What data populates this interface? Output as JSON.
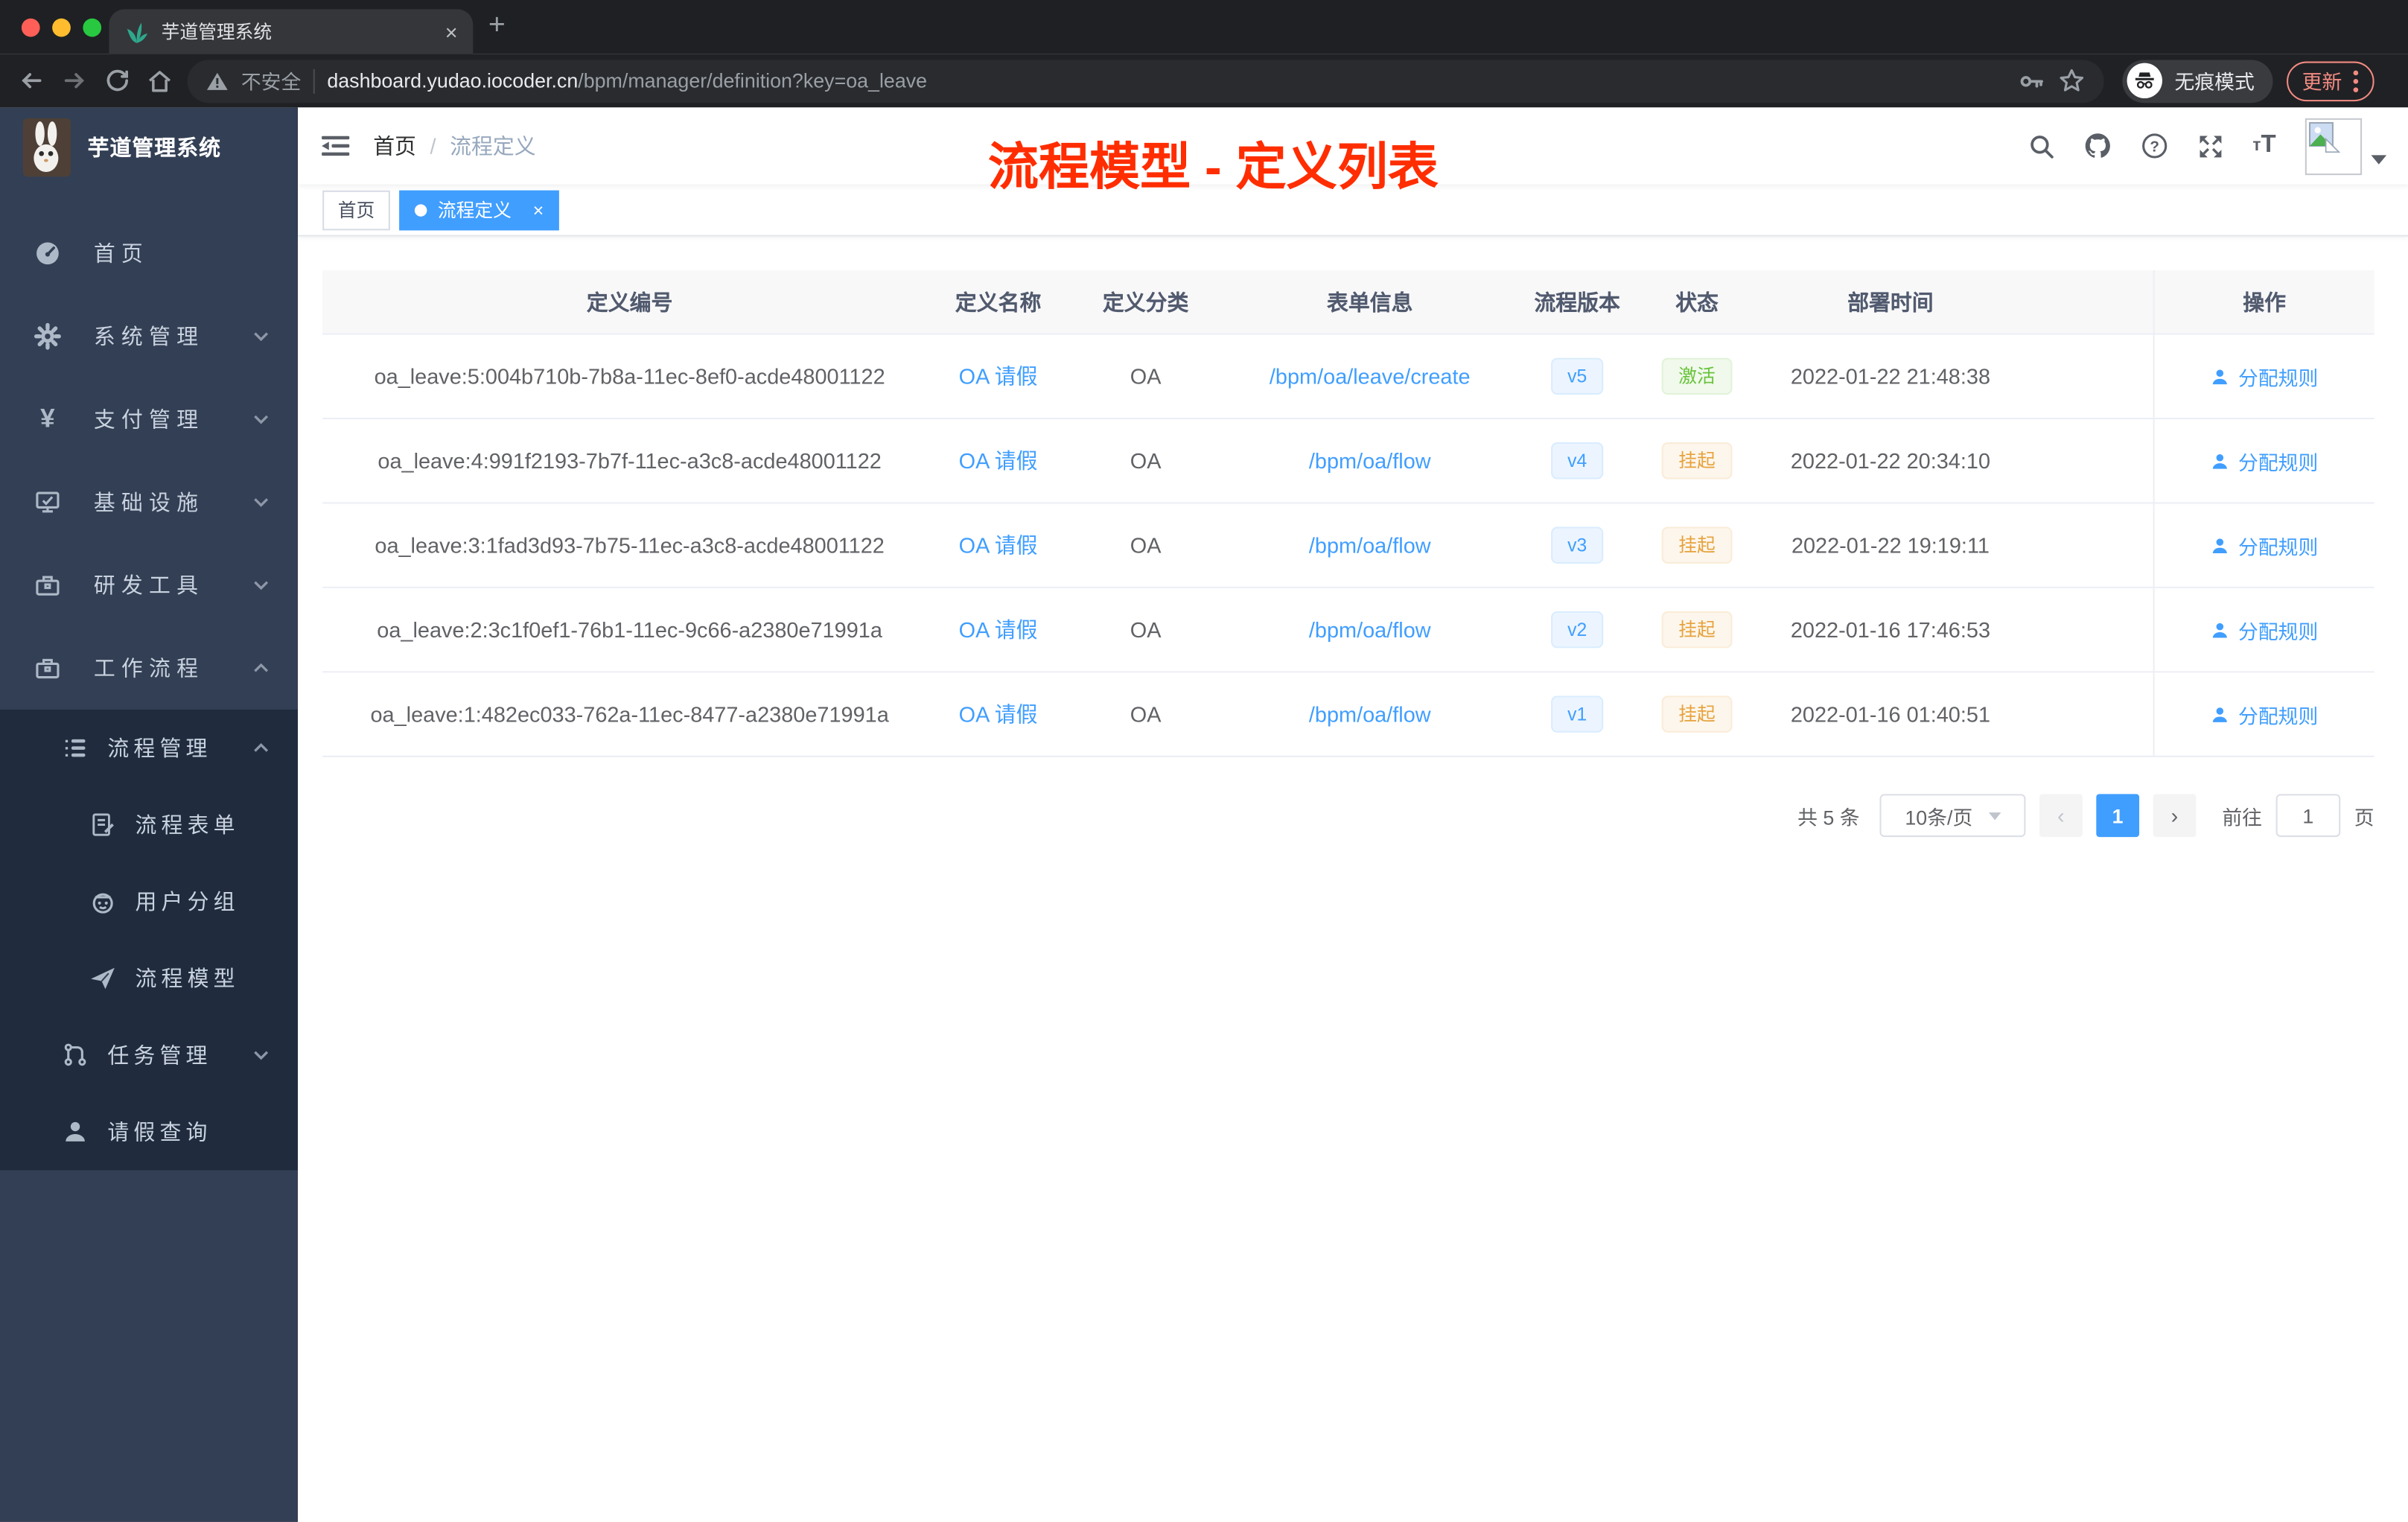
{
  "browser": {
    "tab_title": "芋道管理系统",
    "new_tab_label": "+",
    "close_tab_label": "×",
    "security_label": "不安全",
    "url_host": "dashboard.yudao.iocoder.cn",
    "url_path": "/bpm/manager/definition?key=oa_leave",
    "incognito_label": "无痕模式",
    "update_label": "更新"
  },
  "sidebar": {
    "app_title": "芋道管理系统",
    "items": [
      {
        "label": "首页",
        "icon": "gauge-icon"
      },
      {
        "label": "系统管理",
        "icon": "gear-icon"
      },
      {
        "label": "支付管理",
        "icon": "yen-icon"
      },
      {
        "label": "基础设施",
        "icon": "monitor-icon"
      },
      {
        "label": "研发工具",
        "icon": "toolbox-icon"
      },
      {
        "label": "工作流程",
        "icon": "briefcase-icon",
        "children": [
          {
            "label": "流程管理",
            "icon": "list-icon",
            "children": [
              {
                "label": "流程表单",
                "icon": "form-doc-icon"
              },
              {
                "label": "用户分组",
                "icon": "robot-icon"
              },
              {
                "label": "流程模型",
                "icon": "paper-plane-icon"
              }
            ]
          },
          {
            "label": "任务管理",
            "icon": "branch-icon"
          },
          {
            "label": "请假查询",
            "icon": "person-icon"
          }
        ]
      }
    ]
  },
  "header": {
    "breadcrumb": [
      "首页",
      "流程定义"
    ],
    "separator": "/"
  },
  "annotation": {
    "text": "流程模型 - 定义列表",
    "color": "#ff2d00"
  },
  "tags": [
    {
      "label": "首页",
      "active": false
    },
    {
      "label": "流程定义",
      "active": true
    }
  ],
  "table": {
    "columns": [
      "定义编号",
      "定义名称",
      "定义分类",
      "表单信息",
      "流程版本",
      "状态",
      "部署时间",
      "操作"
    ],
    "rows": [
      {
        "id": "oa_leave:5:004b710b-7b8a-11ec-8ef0-acde48001122",
        "name": "OA 请假",
        "category": "OA",
        "form": "/bpm/oa/leave/create",
        "version": "v5",
        "status": "激活",
        "status_type": "success",
        "deployed_at": "2022-01-22 21:48:38",
        "action": "分配规则"
      },
      {
        "id": "oa_leave:4:991f2193-7b7f-11ec-a3c8-acde48001122",
        "name": "OA 请假",
        "category": "OA",
        "form": "/bpm/oa/flow",
        "version": "v4",
        "status": "挂起",
        "status_type": "warning",
        "deployed_at": "2022-01-22 20:34:10",
        "action": "分配规则"
      },
      {
        "id": "oa_leave:3:1fad3d93-7b75-11ec-a3c8-acde48001122",
        "name": "OA 请假",
        "category": "OA",
        "form": "/bpm/oa/flow",
        "version": "v3",
        "status": "挂起",
        "status_type": "warning",
        "deployed_at": "2022-01-22 19:19:11",
        "action": "分配规则"
      },
      {
        "id": "oa_leave:2:3c1f0ef1-76b1-11ec-9c66-a2380e71991a",
        "name": "OA 请假",
        "category": "OA",
        "form": "/bpm/oa/flow",
        "version": "v2",
        "status": "挂起",
        "status_type": "warning",
        "deployed_at": "2022-01-16 17:46:53",
        "action": "分配规则"
      },
      {
        "id": "oa_leave:1:482ec033-762a-11ec-8477-a2380e71991a",
        "name": "OA 请假",
        "category": "OA",
        "form": "/bpm/oa/flow",
        "version": "v1",
        "status": "挂起",
        "status_type": "warning",
        "deployed_at": "2022-01-16 01:40:51",
        "action": "分配规则"
      }
    ]
  },
  "pagination": {
    "total_label": "共 5 条",
    "page_size_label": "10条/页",
    "prev_label": "‹",
    "current_page": "1",
    "next_label": "›",
    "goto_label": "前往",
    "goto_value": "1",
    "unit_label": "页"
  },
  "colors": {
    "accent_blue": "#409eff",
    "success_green": "#67c23a",
    "warning_orange": "#e6a23c",
    "annotation_red": "#ff2d00",
    "sidebar_bg": "#333f54",
    "submenu_bg": "#202c3e",
    "chrome_update_red": "#f28b82",
    "tab_strip_bg": "#1e2023",
    "toolbar_bg": "#202124"
  }
}
